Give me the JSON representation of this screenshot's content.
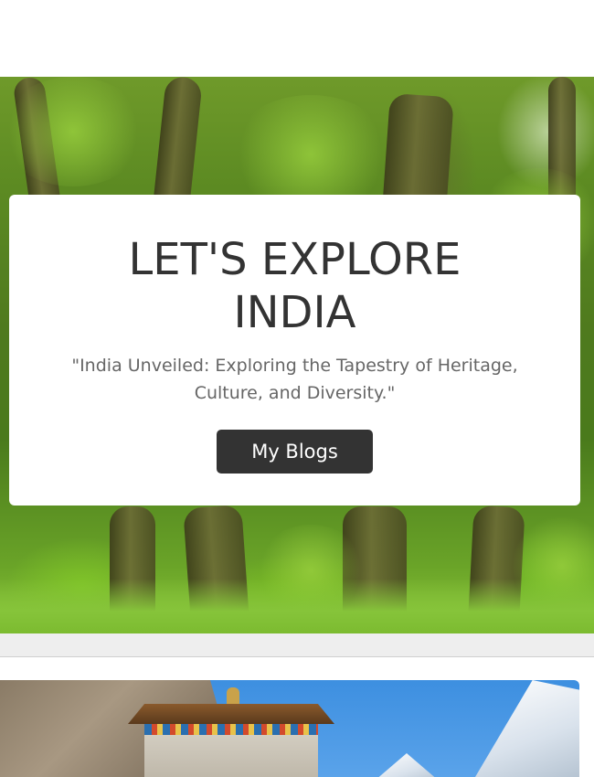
{
  "hero": {
    "title": "LET'S EXPLORE INDIA",
    "subtitle": "\"India Unveiled: Exploring the Tapestry of Heritage, Culture, and Diversity.\"",
    "button_label": "My Blogs",
    "background": "forest-image"
  },
  "card": {
    "image": "temple-mountain-image"
  },
  "colors": {
    "card_bg": "#ffffff",
    "title_text": "#333333",
    "subtitle_text": "#666666",
    "button_bg": "#333333",
    "button_text": "#ffffff",
    "band_bg": "#eeeeee"
  }
}
